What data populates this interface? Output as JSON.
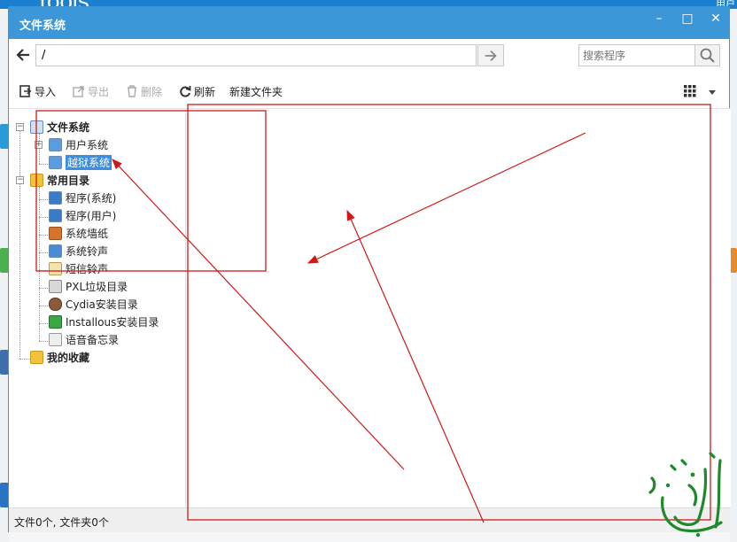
{
  "background": {
    "logo_text": "Tools",
    "user_text": "用户"
  },
  "window": {
    "title": "文件系统",
    "minimize_glyph": "–",
    "maximize_glyph": "□",
    "close_glyph": "✕"
  },
  "address": {
    "path": "/",
    "search_placeholder": "搜索程序"
  },
  "toolbar": {
    "import_label": "导入",
    "export_label": "导出",
    "delete_label": "删除",
    "refresh_label": "刷新",
    "new_folder_label": "新建文件夹"
  },
  "tree": {
    "root_label": "文件系统",
    "user_system": "用户系统",
    "jailbreak_system": "越狱系统",
    "common_dirs": "常用目录",
    "apps_system": "程序(系统)",
    "apps_user": "程序(用户)",
    "wallpaper": "系统墙纸",
    "ringtone": "系统铃声",
    "sms_tone": "短信铃声",
    "pxl_dir": "PXL垃圾目录",
    "cydia_dir": "Cydia安装目录",
    "installous_dir": "Installous安装目录",
    "voice_memo": "语音备忘录",
    "favorites": "我的收藏"
  },
  "status": {
    "text": "文件0个, 文件夹0个"
  },
  "colors": {
    "titlebar": "#3c97d9",
    "selection": "#3c8ee0",
    "annotation_red": "#d01818",
    "watermark_green": "#1e8a2c"
  }
}
